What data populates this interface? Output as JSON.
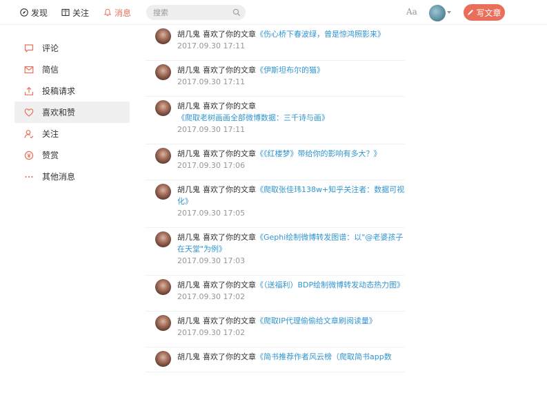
{
  "nav": {
    "items": [
      {
        "label": "发现",
        "icon": "compass-icon"
      },
      {
        "label": "关注",
        "icon": "book-icon"
      },
      {
        "label": "消息",
        "icon": "bell-icon",
        "active": true
      }
    ],
    "search_placeholder": "搜索",
    "font_toggle": "Aa",
    "write_label": "写文章"
  },
  "sidebar": {
    "items": [
      {
        "label": "评论",
        "icon": "comment-icon"
      },
      {
        "label": "简信",
        "icon": "mail-icon"
      },
      {
        "label": "投稿请求",
        "icon": "upload-icon"
      },
      {
        "label": "喜欢和赞",
        "icon": "heart-icon",
        "active": true
      },
      {
        "label": "关注",
        "icon": "user-follow-icon"
      },
      {
        "label": "赞赏",
        "icon": "yen-icon"
      },
      {
        "label": "其他消息",
        "icon": "more-icon"
      }
    ]
  },
  "notifications": [
    {
      "user": "胡几鬼",
      "action": "喜欢了你的文章",
      "article": "《伤心桥下春波绿，曾是惊鸿照影来》",
      "time": "2017.09.30 17:11"
    },
    {
      "user": "胡几鬼",
      "action": "喜欢了你的文章",
      "article": "《伊斯坦布尔的猫》",
      "time": "2017.09.30 17:11"
    },
    {
      "user": "胡几鬼",
      "action": "喜欢了你的文章",
      "article": "《爬取老树画画全部微博数据：三千诗与画》",
      "time": "2017.09.30 17:11"
    },
    {
      "user": "胡几鬼",
      "action": "喜欢了你的文章",
      "article": "《《红楼梦》带给你的影响有多大？》",
      "time": "2017.09.30 17:06"
    },
    {
      "user": "胡几鬼",
      "action": "喜欢了你的文章",
      "article": "《爬取张佳玮138w+知乎关注者：数据可视化》",
      "time": "2017.09.30 17:05"
    },
    {
      "user": "胡几鬼",
      "action": "喜欢了你的文章",
      "article": "《Gephi绘制微博转发图谱：以\"@老婆孩子在天堂\"为例》",
      "time": "2017.09.30 17:03"
    },
    {
      "user": "胡几鬼",
      "action": "喜欢了你的文章",
      "article": "《（送福利）BDP绘制微博转发动态热力图》",
      "time": "2017.09.30 17:02"
    },
    {
      "user": "胡几鬼",
      "action": "喜欢了你的文章",
      "article": "《爬取IP代理偷偷给文章刷阅读量》",
      "time": "2017.09.30 17:02"
    },
    {
      "user": "胡几鬼",
      "action": "喜欢了你的文章",
      "article": "《简书推荐作者风云榜（爬取简书app数",
      "time": ""
    }
  ],
  "colors": {
    "accent": "#ea6f5a",
    "link": "#3194d0",
    "muted": "#969696"
  }
}
